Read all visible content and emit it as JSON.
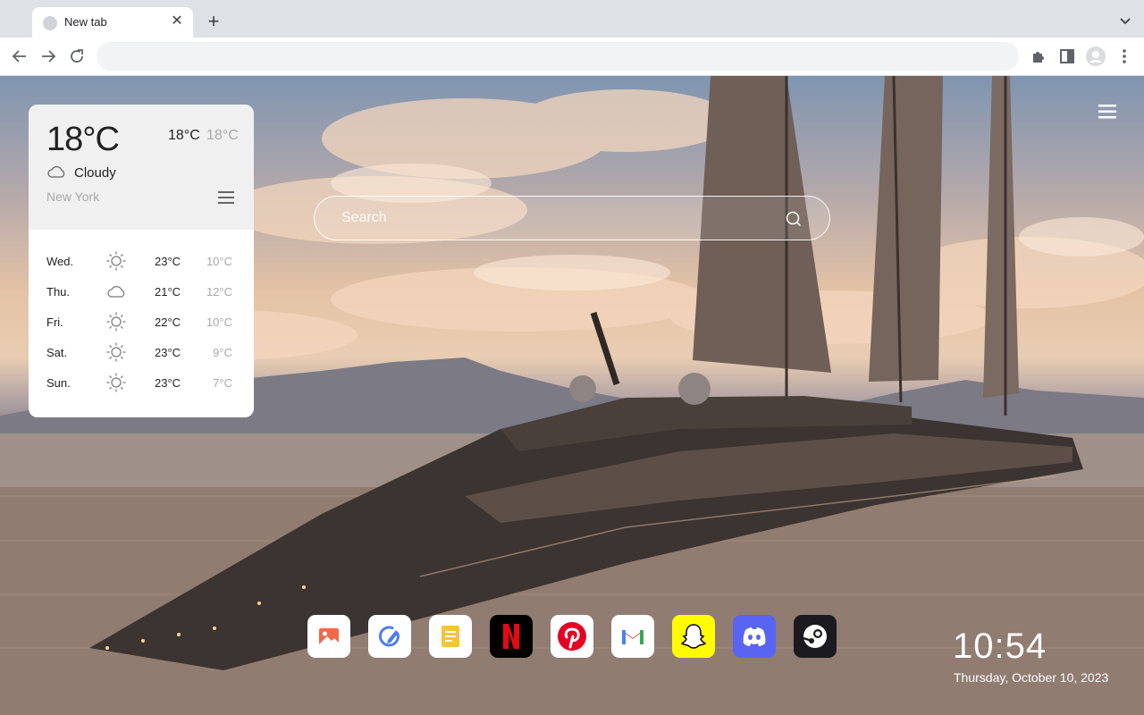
{
  "browser": {
    "tab_title": "New tab",
    "address_value": ""
  },
  "weather": {
    "current_temp": "18°C",
    "high": "18°C",
    "low": "18°C",
    "condition": "Cloudy",
    "condition_icon": "cloud-icon",
    "city": "New York",
    "forecast": [
      {
        "day": "Wed.",
        "icon": "sun-icon",
        "high": "23°C",
        "low": "10°C"
      },
      {
        "day": "Thu.",
        "icon": "cloud-icon",
        "high": "21°C",
        "low": "12°C"
      },
      {
        "day": "Fri.",
        "icon": "sun-icon",
        "high": "22°C",
        "low": "10°C"
      },
      {
        "day": "Sat.",
        "icon": "sun-icon",
        "high": "23°C",
        "low": "9°C"
      },
      {
        "day": "Sun.",
        "icon": "sun-icon",
        "high": "23°C",
        "low": "7°C"
      }
    ]
  },
  "search": {
    "placeholder": "Search"
  },
  "apps": [
    {
      "name": "photos",
      "icon": "photos-icon",
      "color": "#ffffff"
    },
    {
      "name": "editor",
      "icon": "pen-circle-icon",
      "color": "#ffffff"
    },
    {
      "name": "notes",
      "icon": "notes-icon",
      "color": "#ffffff"
    },
    {
      "name": "netflix",
      "icon": "netflix-icon",
      "color": "#000000"
    },
    {
      "name": "pinterest",
      "icon": "pinterest-icon",
      "color": "#ffffff"
    },
    {
      "name": "gmail",
      "icon": "gmail-icon",
      "color": "#ffffff"
    },
    {
      "name": "snapchat",
      "icon": "snapchat-icon",
      "color": "#fffc00"
    },
    {
      "name": "discord",
      "icon": "discord-icon",
      "color": "#5865f2"
    },
    {
      "name": "steam",
      "icon": "steam-icon",
      "color": "#1b1b1f"
    }
  ],
  "clock": {
    "time": "10:54",
    "date": "Thursday, October 10, 2023"
  }
}
